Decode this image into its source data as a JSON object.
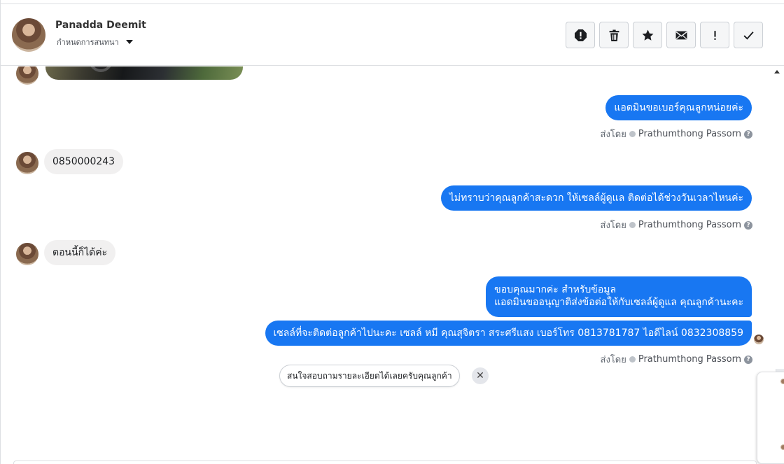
{
  "header": {
    "user_name": "Panadda Deemit",
    "convo_menu_label": "กำหนดการสนทนา",
    "toolbar": [
      {
        "icon": "spam-icon",
        "label": "mark-spam"
      },
      {
        "icon": "trash-icon",
        "label": "delete"
      },
      {
        "icon": "star-icon",
        "label": "star"
      },
      {
        "icon": "envelope-icon",
        "label": "mark-unread"
      },
      {
        "icon": "exclamation-icon",
        "label": "follow-up"
      },
      {
        "icon": "check-icon",
        "label": "done"
      }
    ]
  },
  "messages": {
    "out1": "แอดมินขอเบอร์คุณลูกหน่อยค่ะ",
    "in1": "0850000243",
    "out2": "ไม่ทราบว่าคุณลูกค้าสะดวก ให้เซลล์ผู้ดูแล ติดต่อได้ช่วงวันเวลาไหนค่ะ",
    "in2": "ตอนนี้ก็ได้ค่ะ",
    "out3_line1": "ขอบคุณมากค่ะ สำหรับข้อมูล",
    "out3_line2": "แอดมินขออนุญาติส่งข้อต่อให้กับเซลล์ผู้ดูแล คุณลูกค้านะคะ",
    "out4": "เซลล์ที่จะติดต่อลูกค้าไปนะคะ เซลล์ หมี คุณสุจิตรา สระศรีแสง เบอร์โทร 0813781787 ไอดีไลน์ 0832308859"
  },
  "sent_by": {
    "prefix": "ส่งโดย",
    "name": "Prathumthong Passorn"
  },
  "suggestion": {
    "text": "สนใจสอบถามรายละเอียดได้เลยครับคุณลูกค้า",
    "close": "✕"
  }
}
